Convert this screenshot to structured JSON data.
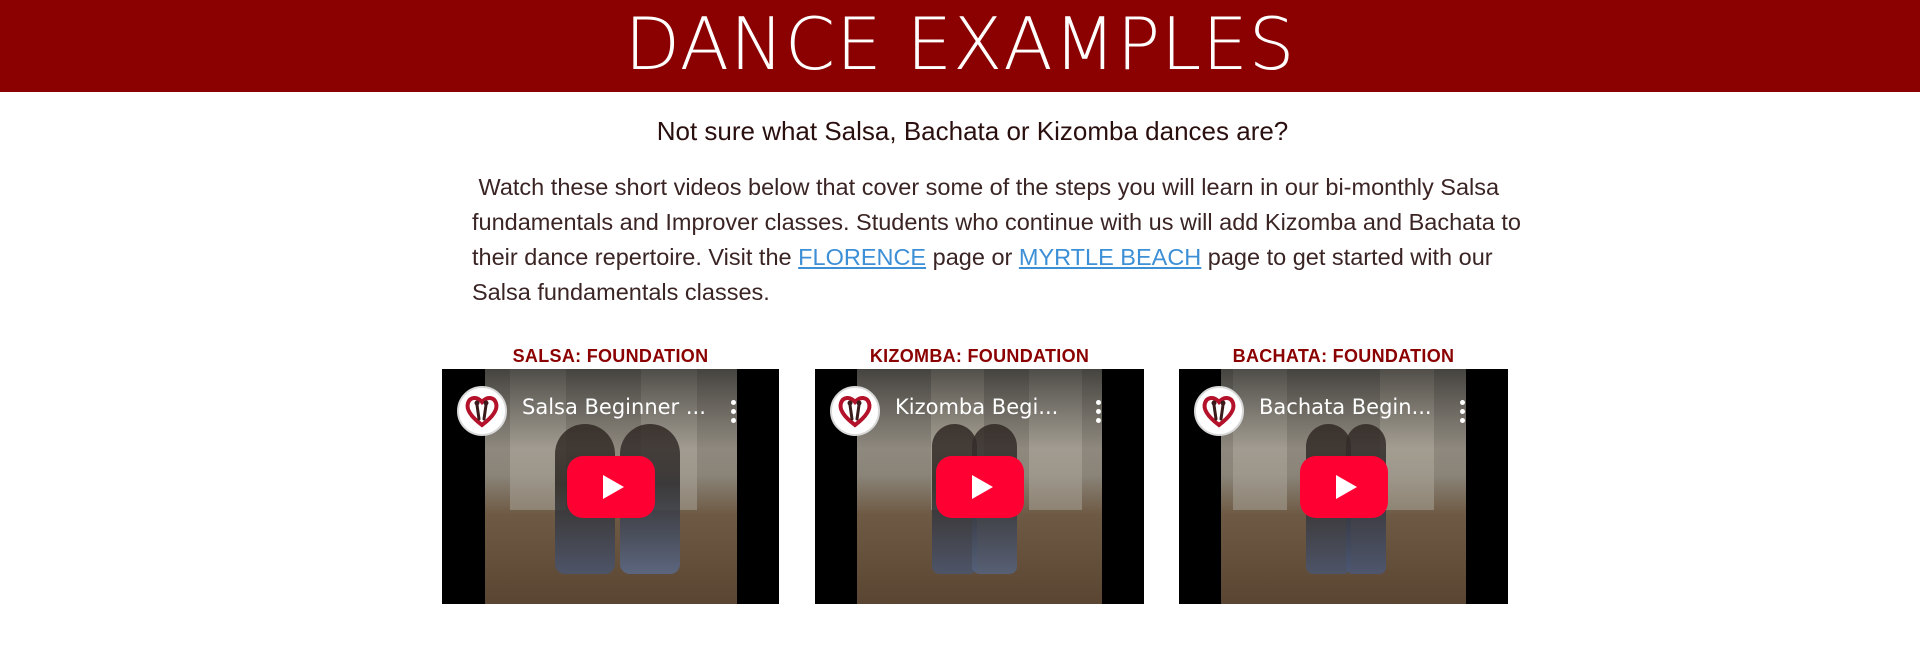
{
  "banner": {
    "title": "DANCE EXAMPLES"
  },
  "subtitle": "Not sure what Salsa, Bachata or Kizomba dances are?",
  "intro": {
    "before": " Watch these short videos below that cover some of the steps you will learn in our bi-monthly Salsa fundamentals and Improver classes. Students who continue with us will add Kizomba and Bachata to their dance repertoire. Visit the ",
    "link1": "FLORENCE",
    "middle": " page or ",
    "link2": "MYRTLE BEACH",
    "after": " page to get started with our Salsa fundamentals classes."
  },
  "colors": {
    "banner": "#8b0000",
    "video_title": "#8b0000",
    "link": "#3d8fd6",
    "play_button": "#ff0033"
  },
  "videos": [
    {
      "heading": "SALSA: FOUNDATION",
      "title": "Salsa Beginner ...",
      "play_icon": "play-icon",
      "logo_icon": "heart-dancers-logo-icon",
      "menu_icon": "more-vert-icon"
    },
    {
      "heading": "KIZOMBA: FOUNDATION",
      "title": "Kizomba Begi...",
      "play_icon": "play-icon",
      "logo_icon": "heart-dancers-logo-icon",
      "menu_icon": "more-vert-icon"
    },
    {
      "heading": "BACHATA: FOUNDATION",
      "title": "Bachata Begin...",
      "play_icon": "play-icon",
      "logo_icon": "heart-dancers-logo-icon",
      "menu_icon": "more-vert-icon"
    }
  ]
}
